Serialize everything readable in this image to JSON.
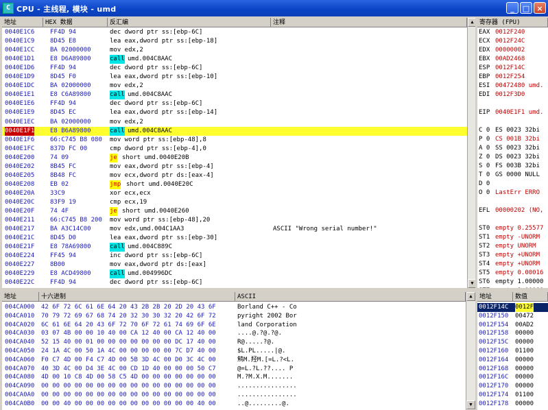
{
  "window": {
    "title": "CPU - 主线程, 模块 - umd",
    "icon_letter": "C",
    "minimize": "_",
    "maximize": "□",
    "close": "×"
  },
  "disasm": {
    "headers": {
      "addr": "地址",
      "hex": "HEX 数据",
      "asm": "反汇编",
      "comment": "注释"
    },
    "rows": [
      {
        "addr": "0040E1C6",
        "hex": "FF4D 94",
        "asm": "dec dword ptr ss:[ebp-6C]"
      },
      {
        "addr": "0040E1C9",
        "hex": "8D45 E8",
        "asm": "lea eax,dword ptr ss:[ebp-18]"
      },
      {
        "addr": "0040E1CC",
        "hex": "BA 02000000",
        "asm": "mov edx,2"
      },
      {
        "addr": "0040E1D1",
        "hex": "E8 D6A89800",
        "call": "call",
        "asm": "umd.004C8AAC"
      },
      {
        "addr": "0040E1D6",
        "hex": "FF4D 94",
        "asm": "dec dword ptr ss:[ebp-6C]"
      },
      {
        "addr": "0040E1D9",
        "hex": "8D45 F0",
        "asm": "lea eax,dword ptr ss:[ebp-10]"
      },
      {
        "addr": "0040E1DC",
        "hex": "BA 02000000",
        "asm": "mov edx,2"
      },
      {
        "addr": "0040E1E1",
        "hex": "E8 C6A89800",
        "call": "call",
        "asm": "umd.004C8AAC"
      },
      {
        "addr": "0040E1E6",
        "hex": "FF4D 94",
        "asm": "dec dword ptr ss:[ebp-6C]"
      },
      {
        "addr": "0040E1E9",
        "hex": "8D45 EC",
        "asm": "lea eax,dword ptr ss:[ebp-14]"
      },
      {
        "addr": "0040E1EC",
        "hex": "BA 02000000",
        "asm": "mov edx,2"
      },
      {
        "addr": "0040E1F1",
        "hex": "E8 B6A89800",
        "call": "call",
        "asm": "umd.004C8AAC",
        "selected": true
      },
      {
        "addr": "0040E1F6",
        "hex": "66:C745 B8 080",
        "asm": "mov word ptr ss:[ebp-48],8"
      },
      {
        "addr": "0040E1FC",
        "hex": "837D FC 00",
        "asm": "cmp dword ptr ss:[ebp-4],0"
      },
      {
        "addr": "0040E200",
        "hex": "74 09",
        "jmp": "je",
        "asm": "short umd.0040E20B"
      },
      {
        "addr": "0040E202",
        "hex": "8B45 FC",
        "asm": "mov eax,dword ptr ss:[ebp-4]"
      },
      {
        "addr": "0040E205",
        "hex": "8B48 FC",
        "asm": "mov ecx,dword ptr ds:[eax-4]"
      },
      {
        "addr": "0040E208",
        "hex": "EB 02",
        "jmp": "jmp",
        "asm": "short umd.0040E20C"
      },
      {
        "addr": "0040E20A",
        "hex": "33C9",
        "asm": "xor ecx,ecx"
      },
      {
        "addr": "0040E20C",
        "hex": "83F9 19",
        "asm": "cmp ecx,19"
      },
      {
        "addr": "0040E20F",
        "hex": "74 4F",
        "jmp": "je",
        "asm": "short umd.0040E260"
      },
      {
        "addr": "0040E211",
        "hex": "66:C745 B8 200",
        "asm": "mov word ptr ss:[ebp-48],20"
      },
      {
        "addr": "0040E217",
        "hex": "BA A3C14C00",
        "asm": "mov edx,umd.004C1AA3",
        "comment": "ASCII \"Wrong serial number!\""
      },
      {
        "addr": "0040E21C",
        "hex": "8D45 D0",
        "asm": "lea eax,dword ptr ss:[ebp-30]"
      },
      {
        "addr": "0040E21F",
        "hex": "E8 78A69800",
        "call": "call",
        "asm": "umd.004C889C"
      },
      {
        "addr": "0040E224",
        "hex": "FF45 94",
        "asm": "inc dword ptr ss:[ebp-6C]"
      },
      {
        "addr": "0040E227",
        "hex": "8B00",
        "asm": "mov eax,dword ptr ds:[eax]"
      },
      {
        "addr": "0040E229",
        "hex": "E8 ACD49800",
        "call": "call",
        "asm": "umd.004996DC"
      },
      {
        "addr": "0040E22C",
        "hex": "FF4D 94",
        "asm": "dec dword ptr ss:[ebp-6C]"
      }
    ]
  },
  "registers": {
    "header": "寄存器 (FPU)",
    "rows": [
      {
        "name": "EAX",
        "val": "0012F240",
        "red": true
      },
      {
        "name": "ECX",
        "val": "0012F24C",
        "red": true
      },
      {
        "name": "EDX",
        "val": "00000002",
        "red": true
      },
      {
        "name": "EBX",
        "val": "00AD2468",
        "red": true
      },
      {
        "name": "ESP",
        "val": "0012F14C",
        "red": true
      },
      {
        "name": "EBP",
        "val": "0012F254",
        "red": true
      },
      {
        "name": "ESI",
        "val": "00472480 umd.",
        "red": true
      },
      {
        "name": "EDI",
        "val": "0012F3D0",
        "red": true
      },
      {
        "name": "",
        "val": ""
      },
      {
        "name": "EIP",
        "val": "0040E1F1 umd.",
        "red": true
      },
      {
        "name": "",
        "val": ""
      },
      {
        "name": "C 0",
        "val": "ES 0023 32bi"
      },
      {
        "name": "P 0",
        "val": "CS 001B 32bi",
        "red": true
      },
      {
        "name": "A 0",
        "val": "SS 0023 32bi"
      },
      {
        "name": "Z 0",
        "val": "DS 0023 32bi"
      },
      {
        "name": "S 0",
        "val": "FS 003B 32bi"
      },
      {
        "name": "T 0",
        "val": "GS 0000 NULL"
      },
      {
        "name": "D 0",
        "val": ""
      },
      {
        "name": "O 0",
        "val": "LastErr ERRO",
        "red": true
      },
      {
        "name": "",
        "val": ""
      },
      {
        "name": "EFL",
        "val": "00000202 (NO,",
        "red": true
      },
      {
        "name": "",
        "val": ""
      },
      {
        "name": "ST0",
        "val": "empty 0.25577",
        "red": true
      },
      {
        "name": "ST1",
        "val": "empty -UNORM",
        "red": true
      },
      {
        "name": "ST2",
        "val": "empty  UNORM",
        "red": true
      },
      {
        "name": "ST3",
        "val": "empty +UNORM",
        "red": true
      },
      {
        "name": "ST4",
        "val": "empty +UNORM",
        "red": true
      },
      {
        "name": "ST5",
        "val": "empty 0.00016",
        "red": true
      },
      {
        "name": "ST6",
        "val": "empty 1.00000"
      },
      {
        "name": "ST7",
        "val": "empty 1.00000"
      },
      {
        "name": "",
        "val": "3"
      },
      {
        "name": "FST",
        "val": "4000  Cond 1"
      }
    ]
  },
  "dump": {
    "headers": {
      "addr": "地址",
      "hex": "十六进制",
      "ascii": "ASCII"
    },
    "rows": [
      {
        "addr": "004CA000",
        "hex": "42 6F 72 6C 61 6E 64 20 43 2B 2B 20 2D 20 43 6F",
        "ascii": "Borland C++ - Co"
      },
      {
        "addr": "004CA010",
        "hex": "70 79 72 69 67 68 74 20 32 30 30 32 20 42 6F 72",
        "ascii": "pyright 2002 Bor"
      },
      {
        "addr": "004CA020",
        "hex": "6C 61 6E 64 20 43 6F 72 70 6F 72 61 74 69 6F 6E",
        "ascii": "land Corporation"
      },
      {
        "addr": "004CA030",
        "hex": "03 07 4B 00 00 10 40 00 CA 12 40 00 CA 12 40 00",
        "ascii": "....@.?@.?@."
      },
      {
        "addr": "004CA040",
        "hex": "52 15 40 00 01 00 00 00 00 00 00 00 DC 17 40 00",
        "ascii": "R@.....?@."
      },
      {
        "addr": "004CA050",
        "hex": "24 1A 4C 00 50 1A 4C 00 00 00 00 00 7C D7 40 00",
        "ascii": "$L.PL.....|@."
      },
      {
        "addr": "004CA060",
        "hex": "F0 C7 4D 00 F4 C7 4D 00 5B 3D 4C 00 D0 3C 4C 00",
        "ascii": "鹪M.羟M.[=L.?<L."
      },
      {
        "addr": "004CA070",
        "hex": "40 3D 4C 00 D4 3E 4C 00 CD 1D 40 00 00 00 50 C7",
        "ascii": "@=L.?L.??.... P"
      },
      {
        "addr": "004CA080",
        "hex": "4D 00 10 C8 4D 00 58 C5 4D 00 00 00 00 00 00 00",
        "ascii": "M.?M.X.M......."
      },
      {
        "addr": "004CA090",
        "hex": "00 00 00 00 00 00 00 00 00 00 00 00 00 00 00 00",
        "ascii": "................"
      },
      {
        "addr": "004CA0A0",
        "hex": "00 00 00 00 00 00 00 00 00 00 00 00 00 00 00 00",
        "ascii": "................"
      },
      {
        "addr": "004CA0B0",
        "hex": "00 00 40 00 00 00 00 00 00 00 00 00 00 00 40 00",
        "ascii": "..@.........@."
      }
    ]
  },
  "stack": {
    "headers": {
      "addr": "地址",
      "val": "数值"
    },
    "rows": [
      {
        "addr": "0012F14C",
        "val": "0012F",
        "selected": true
      },
      {
        "addr": "0012F150",
        "val": "00472"
      },
      {
        "addr": "0012F154",
        "val": "00AD2"
      },
      {
        "addr": "0012F158",
        "val": "00000"
      },
      {
        "addr": "0012F15C",
        "val": "00000"
      },
      {
        "addr": "0012F160",
        "val": "01100"
      },
      {
        "addr": "0012F164",
        "val": "00000"
      },
      {
        "addr": "0012F168",
        "val": "00000"
      },
      {
        "addr": "0012F16C",
        "val": "00000"
      },
      {
        "addr": "0012F170",
        "val": "00000"
      },
      {
        "addr": "0012F174",
        "val": "01100"
      },
      {
        "addr": "0012F178",
        "val": "00000"
      }
    ]
  }
}
